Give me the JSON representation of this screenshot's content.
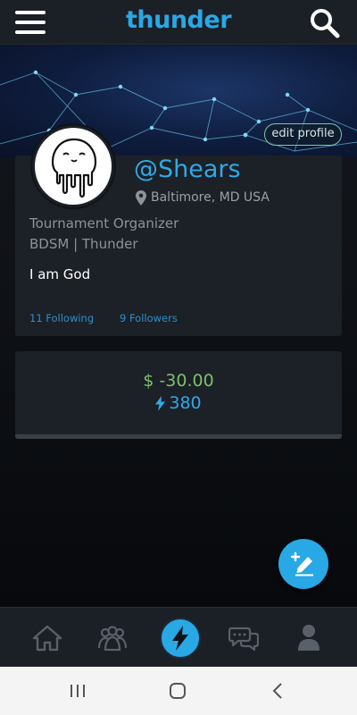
{
  "header": {
    "brand": "thunder",
    "menu_icon": "hamburger-menu-icon",
    "search_icon": "search-icon"
  },
  "profile": {
    "edit_label": "edit profile",
    "handle": "@Shears",
    "location": "Baltimore, MD USA",
    "role": "Tournament Organizer",
    "org": "BDSM | Thunder",
    "bio": "I am God",
    "following": "11 Following",
    "followers": "9 Followers"
  },
  "balance": {
    "money": "$ -30.00",
    "points": "380"
  },
  "fab": {
    "icon": "edit-pencil-plus-icon"
  },
  "bottom_nav": {
    "items": [
      {
        "icon": "home-icon"
      },
      {
        "icon": "groups-icon"
      },
      {
        "icon": "thunder-bolt-icon",
        "active": true
      },
      {
        "icon": "chat-icon"
      },
      {
        "icon": "profile-icon"
      }
    ]
  },
  "system_nav": {
    "items": [
      {
        "icon": "recents-icon"
      },
      {
        "icon": "home-circle-icon"
      },
      {
        "icon": "back-icon"
      }
    ]
  },
  "colors": {
    "accent": "#29a8e6",
    "money": "#7fbf6a",
    "background": "#0b0d12",
    "card": "#1c2027"
  }
}
